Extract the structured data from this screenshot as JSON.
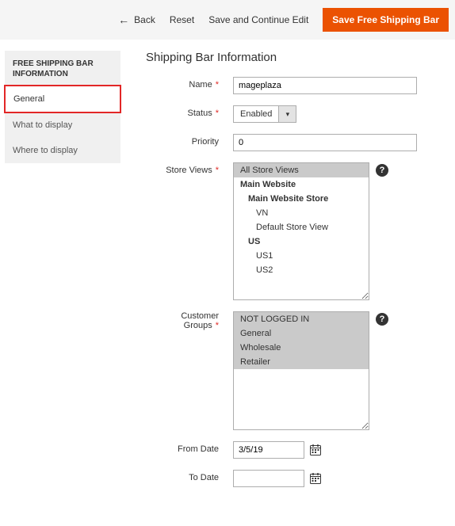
{
  "header": {
    "back": "Back",
    "reset": "Reset",
    "save_continue": "Save and Continue Edit",
    "save": "Save Free Shipping Bar"
  },
  "sidebar": {
    "title": "FREE SHIPPING BAR INFORMATION",
    "items": [
      {
        "label": "General"
      },
      {
        "label": "What to display"
      },
      {
        "label": "Where to display"
      }
    ]
  },
  "page": {
    "title": "Shipping Bar Information"
  },
  "form": {
    "name_label": "Name",
    "name_value": "mageplaza",
    "status_label": "Status",
    "status_value": "Enabled",
    "priority_label": "Priority",
    "priority_value": "0",
    "store_views_label": "Store Views",
    "customer_groups_label": "Customer Groups",
    "from_date_label": "From Date",
    "from_date_value": "3/5/19",
    "to_date_label": "To Date",
    "to_date_value": ""
  },
  "store_views": [
    {
      "label": "All Store Views",
      "hl": true
    },
    {
      "label": "Main Website",
      "bold": true
    },
    {
      "label": "Main Website Store",
      "bold": true,
      "ind": 1
    },
    {
      "label": "VN",
      "ind": 2
    },
    {
      "label": "Default Store View",
      "ind": 2
    },
    {
      "label": "US",
      "bold": true,
      "ind": 1
    },
    {
      "label": "US1",
      "ind": 2
    },
    {
      "label": "US2",
      "ind": 2
    }
  ],
  "customer_groups": [
    {
      "label": "NOT LOGGED IN",
      "hl": true
    },
    {
      "label": "General",
      "hl": true
    },
    {
      "label": "Wholesale",
      "hl": true
    },
    {
      "label": "Retailer",
      "hl": true
    }
  ]
}
